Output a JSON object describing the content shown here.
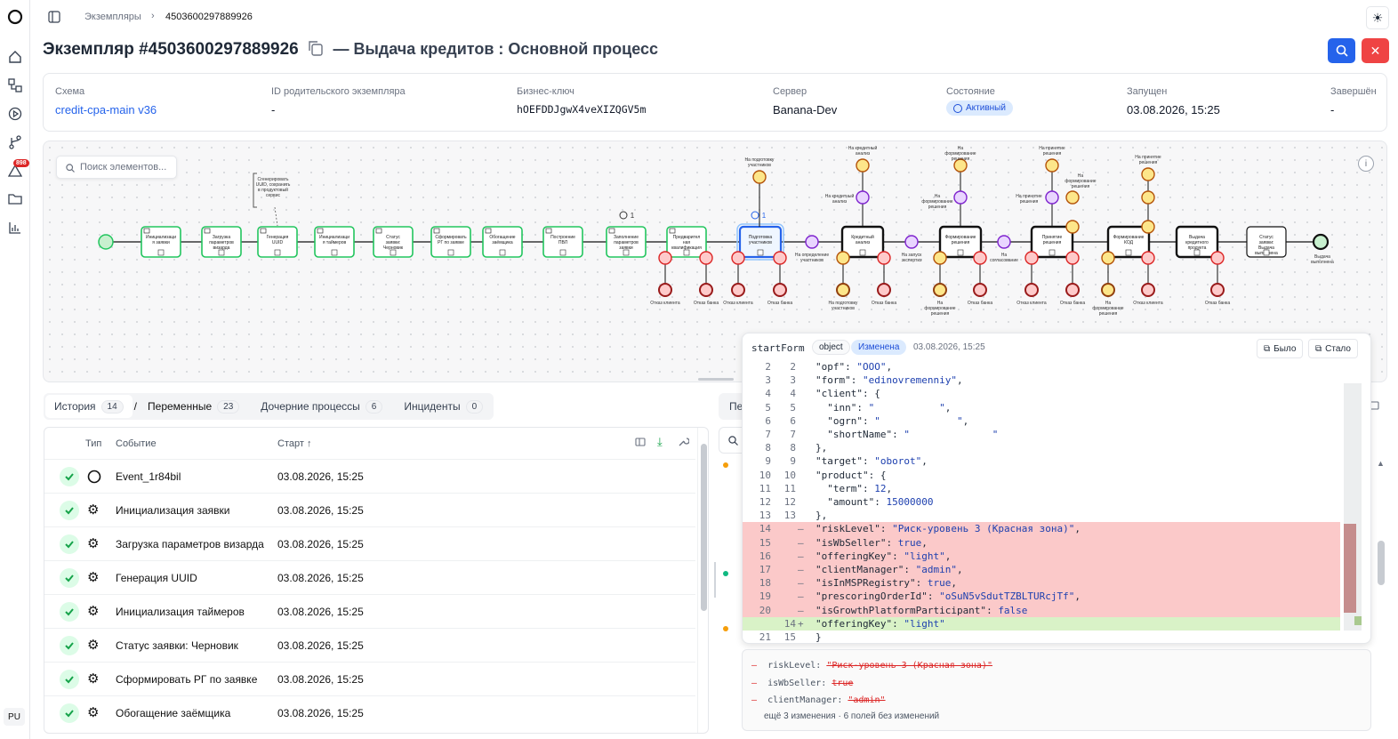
{
  "breadcrumb": {
    "parent": "Экземпляры",
    "current": "4503600297889926"
  },
  "header": {
    "title": "Экземпляр #4503600297889926",
    "subtitle": "— Выдача кредитов : Основной процесс"
  },
  "rail": {
    "alerts_badge": "898",
    "user": "PU"
  },
  "info": [
    {
      "label": "Схема",
      "value": "credit-cpa-main v36"
    },
    {
      "label": "ID родительского экземпляра",
      "value": "-"
    },
    {
      "label": "Бизнес-ключ",
      "value": "hOEFDDJgwX4veXIZQGV5m"
    },
    {
      "label": "Сервер",
      "value": "Banana-Dev"
    },
    {
      "label": "Состояние",
      "value": "Активный"
    },
    {
      "label": "Запущен",
      "value": "03.08.2026, 15:25"
    },
    {
      "label": "Завершён",
      "value": "-"
    }
  ],
  "diagram": {
    "search_placeholder": "Поиск элементов...",
    "annotation": "Сгенерировать UUID, сохранить в продуктовый сервис",
    "tasks": [
      "Инициализаци я заявки",
      "Загрузка параметров визарда",
      "Генерация UUID",
      "Инициализаци я таймеров",
      "Статус заявки: Черновик",
      "Сформировать РГ по заявке",
      "Обогащение заёмщика",
      "Построение ПВЛ",
      "Заполнение параметров заявки",
      "Предварител ная квалификация",
      "Подготовка участников",
      "Кредитный анализ",
      "Формирование решения",
      "Принятие решения",
      "Формирование КОД",
      "Выдача кредитного продукта",
      "Статус заявки: Выдача выполнена"
    ],
    "end_label": "Выдача выполнена",
    "counter_a": "1",
    "counter_b": "1",
    "event_labels": [
      "Отказ клиента",
      "Отказ банка",
      "Отказ клиента",
      "Отказ банка",
      "На определение участников",
      "На запуск экспертиз",
      "На согласование",
      "На подготовку участников",
      "Отказ банка",
      "На формирование решения",
      "Отказ банка",
      "Отказ клиента",
      "Отказ банка",
      "На формирование решения",
      "Отказ клиента",
      "Отказ банка"
    ],
    "top_labels": [
      "На подготовку участников",
      "На кредитный анализ",
      "На кредитный анализ",
      "На формирование решения",
      "На формирование решения",
      "На принятие решения",
      "На принятие решения",
      "На формирование решения",
      "На принятие решения"
    ]
  },
  "tabs": [
    {
      "label": "История",
      "count": "14"
    },
    {
      "label": "Переменные",
      "count": "23"
    },
    {
      "label": "Дочерние процессы",
      "count": "6"
    },
    {
      "label": "Инциденты",
      "count": "0"
    }
  ],
  "tab_separator": "/",
  "history": {
    "columns": {
      "type": "Тип",
      "event": "Событие",
      "start": "Старт"
    },
    "rows": [
      {
        "icon": "circle-icon",
        "event": "Event_1r84bil",
        "start": "03.08.2026, 15:25"
      },
      {
        "icon": "gear-icon",
        "event": "Инициализация заявки",
        "start": "03.08.2026, 15:25"
      },
      {
        "icon": "gear-icon",
        "event": "Загрузка параметров визарда",
        "start": "03.08.2026, 15:25"
      },
      {
        "icon": "gear-icon",
        "event": "Генерация UUID",
        "start": "03.08.2026, 15:25"
      },
      {
        "icon": "gear-icon",
        "event": "Инициализация таймеров",
        "start": "03.08.2026, 15:25"
      },
      {
        "icon": "gear-icon",
        "event": "Статус заявки: Черновик",
        "start": "03.08.2026, 15:25"
      },
      {
        "icon": "gear-icon",
        "event": "Сформировать РГ по заявке",
        "start": "03.08.2026, 15:25"
      },
      {
        "icon": "gear-icon",
        "event": "Обогащение заёмщика",
        "start": "03.08.2026, 15:25"
      }
    ]
  },
  "right_tab_fragment": "Пе",
  "diff": {
    "var_name": "startForm",
    "type_badge": "object",
    "status_badge": "Изменена",
    "timestamp": "03.08.2026, 15:25",
    "before_btn": "Было",
    "after_btn": "Стало",
    "lines": [
      {
        "l": "2",
        "r": "2",
        "m": "",
        "t": "\"opf\": \"ООО\",",
        "kind": "same"
      },
      {
        "l": "3",
        "r": "3",
        "m": "",
        "t": "\"form\": \"edinovremenniy\",",
        "kind": "same"
      },
      {
        "l": "4",
        "r": "4",
        "m": "",
        "t": "\"client\": {",
        "kind": "same"
      },
      {
        "l": "5",
        "r": "5",
        "m": "",
        "t": "  \"inn\": \"           \",",
        "kind": "same"
      },
      {
        "l": "6",
        "r": "6",
        "m": "",
        "t": "  \"ogrn\": \"             \",",
        "kind": "same"
      },
      {
        "l": "7",
        "r": "7",
        "m": "",
        "t": "  \"shortName\": \"              \"",
        "kind": "same"
      },
      {
        "l": "8",
        "r": "8",
        "m": "",
        "t": "},",
        "kind": "same"
      },
      {
        "l": "9",
        "r": "9",
        "m": "",
        "t": "\"target\": \"oborot\",",
        "kind": "same"
      },
      {
        "l": "10",
        "r": "10",
        "m": "",
        "t": "\"product\": {",
        "kind": "same"
      },
      {
        "l": "11",
        "r": "11",
        "m": "",
        "t": "  \"term\": 12,",
        "kind": "same"
      },
      {
        "l": "12",
        "r": "12",
        "m": "",
        "t": "  \"amount\": 15000000",
        "kind": "same"
      },
      {
        "l": "13",
        "r": "13",
        "m": "",
        "t": "},",
        "kind": "same"
      },
      {
        "l": "14",
        "r": "",
        "m": "—",
        "t": "\"riskLevel\": \"Риск-уровень 3 (Красная зона)\",",
        "kind": "del"
      },
      {
        "l": "15",
        "r": "",
        "m": "—",
        "t": "\"isWbSeller\": true,",
        "kind": "del"
      },
      {
        "l": "16",
        "r": "",
        "m": "—",
        "t": "\"offeringKey\": \"light\",",
        "kind": "del"
      },
      {
        "l": "17",
        "r": "",
        "m": "—",
        "t": "\"clientManager\": \"admin\",",
        "kind": "del"
      },
      {
        "l": "18",
        "r": "",
        "m": "—",
        "t": "\"isInMSPRegistry\": true,",
        "kind": "del"
      },
      {
        "l": "19",
        "r": "",
        "m": "—",
        "t": "\"prescoringOrderId\": \"oSuN5vSdutTZBLTURcjTf\",",
        "kind": "del"
      },
      {
        "l": "20",
        "r": "",
        "m": "—",
        "t": "\"isGrowthPlatformParticipant\": false",
        "kind": "del"
      },
      {
        "l": "",
        "r": "14",
        "m": "+",
        "t": "\"offeringKey\": \"light\"",
        "kind": "add"
      },
      {
        "l": "21",
        "r": "15",
        "m": "",
        "t": "}",
        "kind": "same"
      }
    ]
  },
  "summary": {
    "items": [
      {
        "key": "riskLevel:",
        "old": "\"Риск-уровень 3 (Красная зона)\""
      },
      {
        "key": "isWbSeller:",
        "old": "true"
      },
      {
        "key": "clientManager:",
        "old": "\"admin\""
      }
    ],
    "footer": "ещё 3 изменения · 6 полей без изменений"
  },
  "colors": {
    "accent": "#2563eb",
    "danger": "#ef4444",
    "success": "#22c55e",
    "del_bg": "#fecaca",
    "add_bg": "#d9f2c7"
  }
}
